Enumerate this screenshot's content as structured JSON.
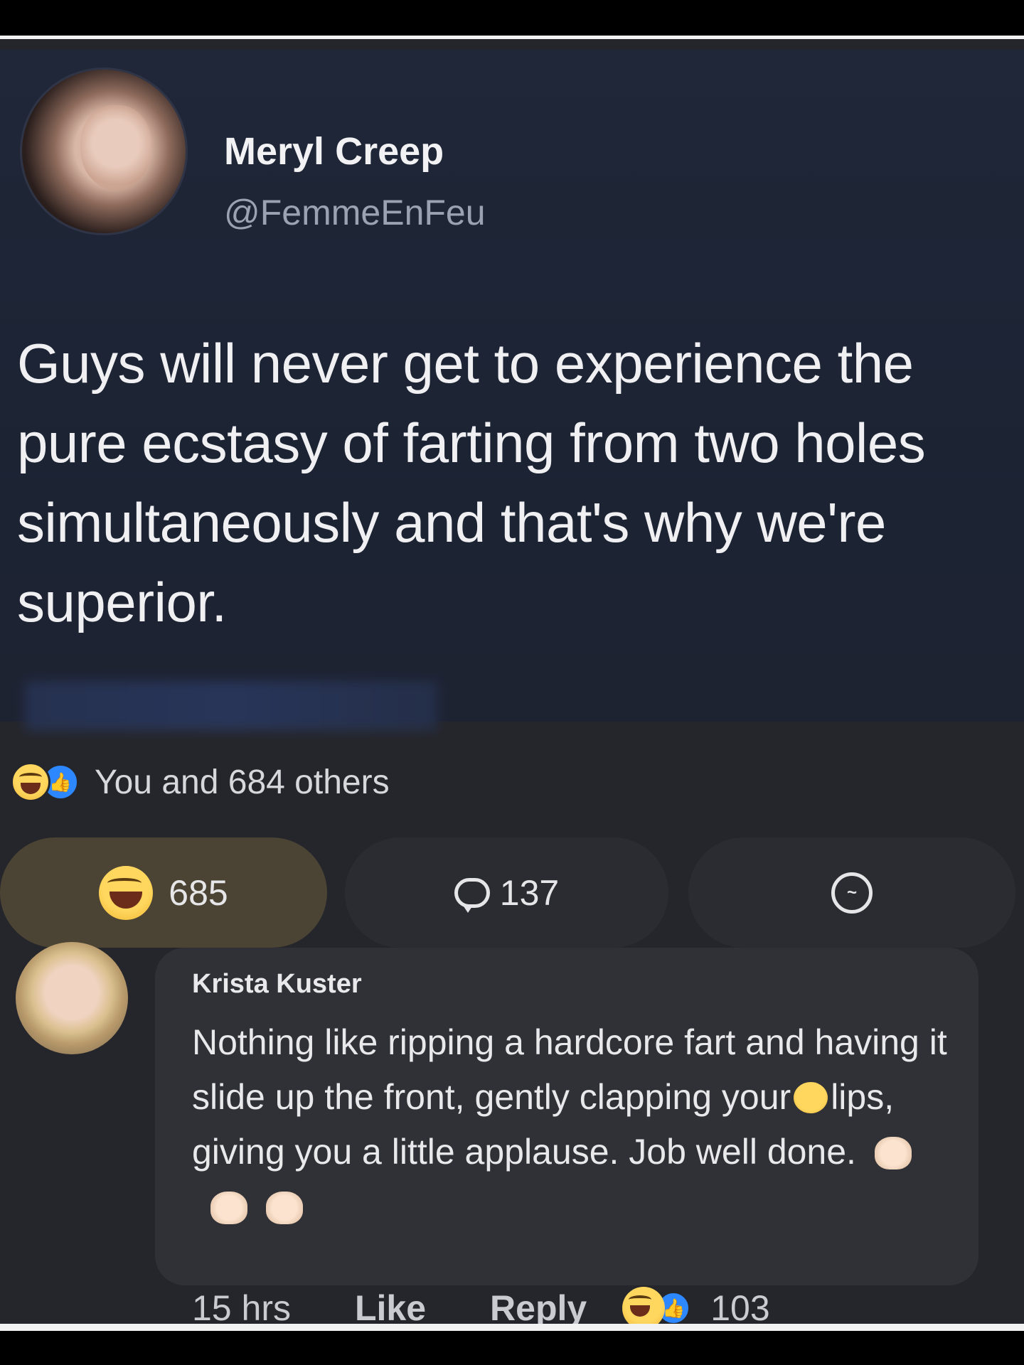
{
  "post": {
    "author_name": "Meryl Creep",
    "author_handle": "@FemmeEnFeu",
    "text": "Guys will never get to experience the pure ecstasy of farting from two holes simultaneously and that's why we're superior."
  },
  "reactions": {
    "summary": "You and 684 others",
    "react_count": "685",
    "comment_count": "137",
    "icons": [
      "haha-emoji-icon",
      "like-icon"
    ]
  },
  "comment": {
    "author": "Krista Kuster",
    "text_part1": "Nothing like ripping a hardcore fart and having it slide up the front, gently clapping your",
    "text_part2": "lips, giving you a little applause. Job well done.",
    "time": "15 hrs",
    "like_label": "Like",
    "reply_label": "Reply",
    "reaction_count": "103"
  },
  "colors": {
    "background": "#25262b",
    "tweet_background": "#1f2738",
    "react_button_active": "#4b4434",
    "button": "#2b2c31",
    "comment_bubble": "#303136",
    "like_blue": "#2d88ff",
    "haha_yellow": "#ffd75e"
  }
}
